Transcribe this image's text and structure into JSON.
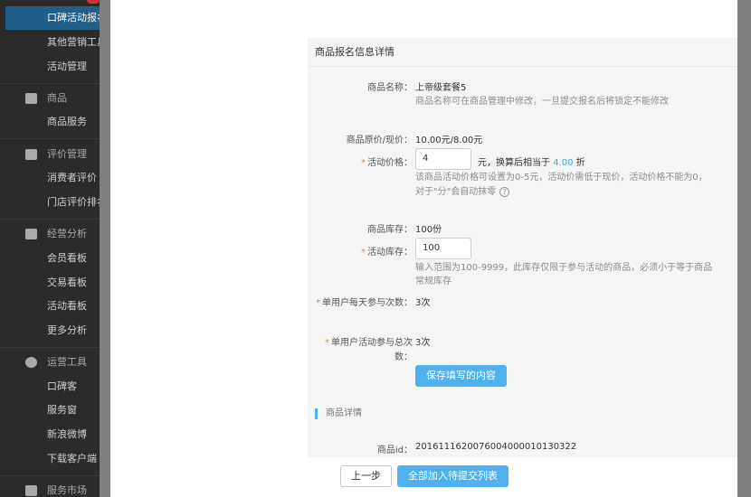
{
  "sidebar": {
    "items": [
      {
        "label": "口碑活动报名",
        "kind": "item",
        "active": true
      },
      {
        "label": "其他营销工具",
        "kind": "item"
      },
      {
        "label": "活动管理",
        "kind": "item"
      },
      {
        "label": "商品",
        "kind": "group",
        "icon": "envelope-icon"
      },
      {
        "label": "商品服务",
        "kind": "item"
      },
      {
        "label": "评价管理",
        "kind": "group",
        "icon": "check-icon"
      },
      {
        "label": "消费者评价",
        "kind": "item"
      },
      {
        "label": "门店评价排名",
        "kind": "item"
      },
      {
        "label": "经营分析",
        "kind": "group",
        "icon": "chart-icon"
      },
      {
        "label": "会员看板",
        "kind": "item"
      },
      {
        "label": "交易看板",
        "kind": "item"
      },
      {
        "label": "活动看板",
        "kind": "item"
      },
      {
        "label": "更多分析",
        "kind": "item"
      },
      {
        "label": "运营工具",
        "kind": "group",
        "icon": "gear-icon"
      },
      {
        "label": "口碑客",
        "kind": "item"
      },
      {
        "label": "服务窗",
        "kind": "item"
      },
      {
        "label": "新浪微博",
        "kind": "item"
      },
      {
        "label": "下载客户端",
        "kind": "item"
      },
      {
        "label": "服务市场",
        "kind": "group",
        "icon": "shop-icon"
      }
    ]
  },
  "panel": {
    "title": "商品报名信息详情",
    "product_name": {
      "label": "商品名称：",
      "value": "上帝级套餐5",
      "hint": "商品名称可在商品管理中修改，一旦提交报名后将锁定不能修改"
    },
    "price": {
      "label": "商品原价/现价：",
      "value": "10.00元/8.00元"
    },
    "activity_price": {
      "label": "活动价格：",
      "input_value": "4",
      "suffix_before": "元，换算后相当于",
      "discount": "4.00",
      "suffix_after": "折",
      "hint_line1": "该商品活动价格可设置为0-5元，活动价需低于现价，活动价格不能为0，",
      "hint_line2": "对于\"分\"会自动抹零"
    },
    "stock": {
      "label": "商品库存：",
      "value": "100份"
    },
    "activity_stock": {
      "label": "活动库存：",
      "input_value": "100",
      "hint_line1": "输入范围为100-9999，此库存仅限于参与活动的商品，必须小于等于商品",
      "hint_line2": "常规库存"
    },
    "daily_limit": {
      "label": "单用户每天参与次数：",
      "value": "3次"
    },
    "total_limit": {
      "label_line1": "单用户活动参与总次",
      "label_line2": "数：",
      "value": "3次"
    },
    "save_button": "保存填写的内容",
    "detail_section": "商品详情",
    "product_id": {
      "label": "商品id：",
      "value": "20161116200760040000101303​22"
    }
  },
  "footer": {
    "prev_button": "上一步",
    "submit_all_button": "全部加入待提交列表"
  },
  "colors": {
    "accent": "#4fb2ee",
    "required": "#f08a24",
    "sidebar_active": "#1f5f8a"
  }
}
